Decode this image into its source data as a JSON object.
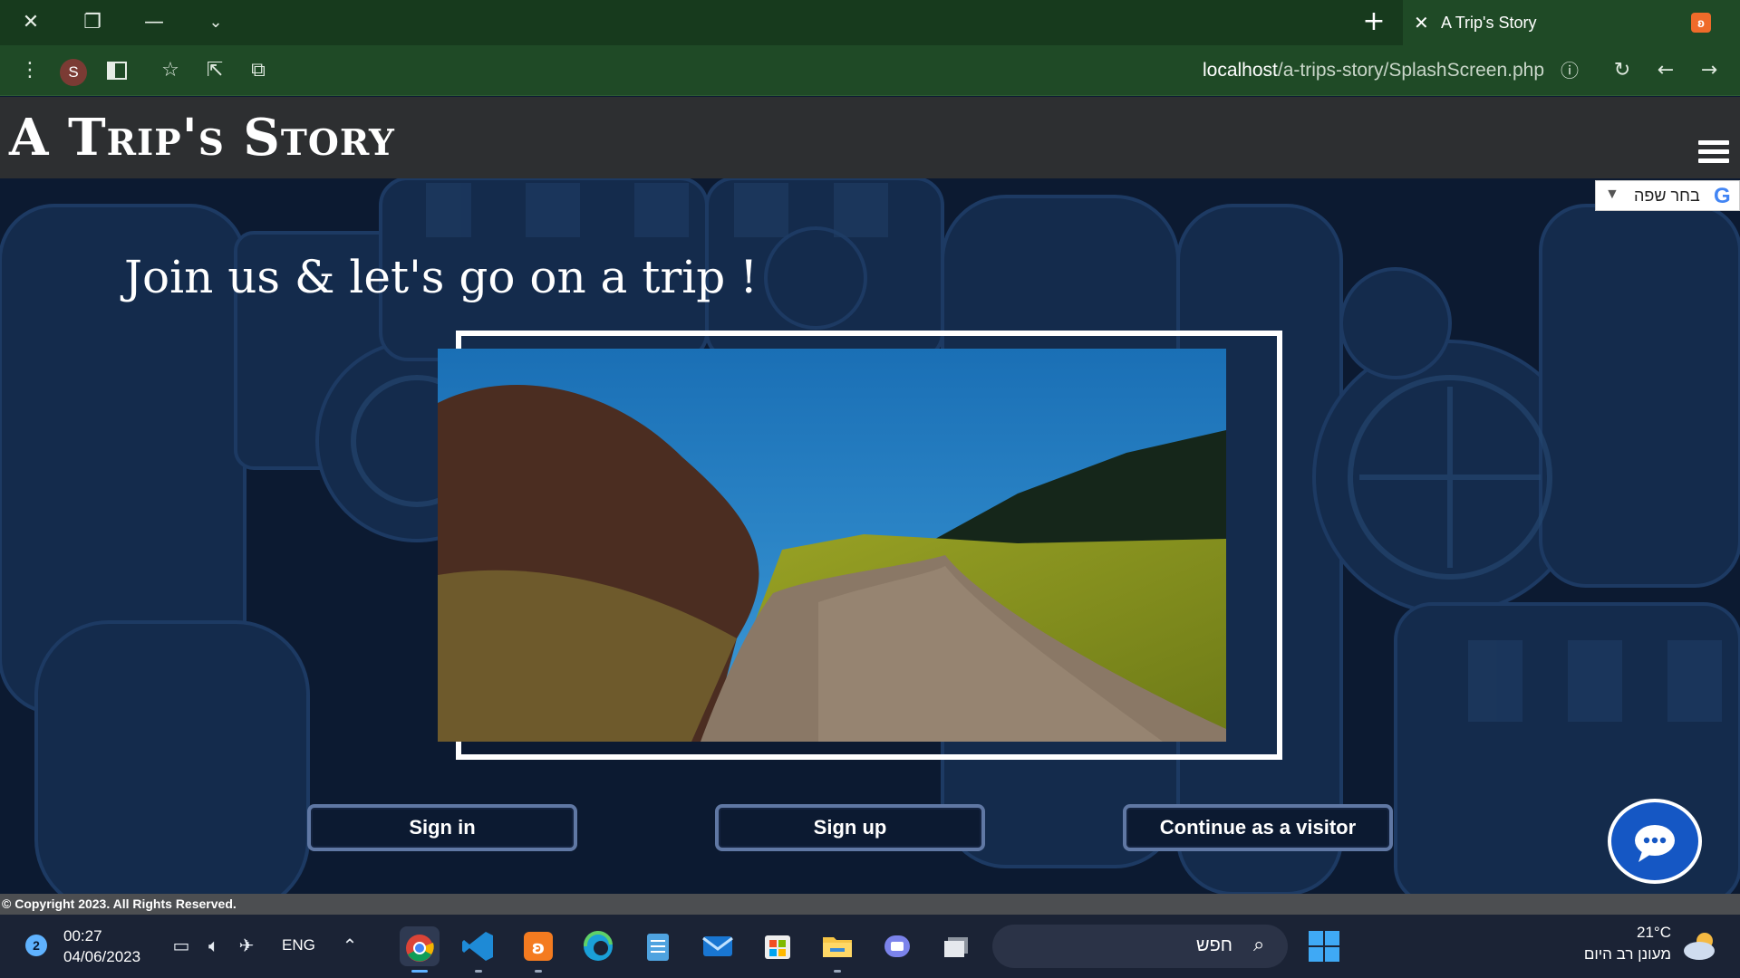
{
  "browser": {
    "tab_title": "A Trip's Story",
    "tab_favicon": "ʚ",
    "url_host": "localhost",
    "url_path": "/a-trips-story/SplashScreen.php",
    "profile_initial": "S"
  },
  "site": {
    "logo": "A Trip's Story",
    "language_widget": "בחר שפה",
    "language_widget_arrow": "▼",
    "language_widget_logo": "G",
    "headline": "Join us & let's go on a trip !",
    "buttons": {
      "sign_in": "Sign in",
      "sign_up": "Sign up",
      "visitor": "Continue as a visitor"
    },
    "footer": "© Copyright 2023. All Rights Reserved."
  },
  "taskbar": {
    "notification_count": "2",
    "time": "00:27",
    "date": "04/06/2023",
    "language": "ENG",
    "search_label": "חפש",
    "weather_temp": "21°C",
    "weather_desc": "מעונן רב היום"
  },
  "colors": {
    "titlebar": "#173a1d",
    "toolbar": "#1f4a26",
    "page_bg": "#0c1a31",
    "header": "#2d2f31",
    "button_border": "#6078a4",
    "chat_button": "#1557c4",
    "footer": "#4c4e51",
    "taskbar": "#1b2335"
  },
  "icons": [
    "close-icon",
    "restore-icon",
    "minimize-icon",
    "chevron-down-icon",
    "plus-icon",
    "menu-dots-icon",
    "sidebar-icon",
    "star-icon",
    "share-icon",
    "extension-icon",
    "info-icon",
    "reload-icon",
    "back-arrow-icon",
    "forward-arrow-icon",
    "hamburger-icon",
    "chat-icon",
    "battery-icon",
    "volume-icon",
    "airplane-icon",
    "chevron-up-icon",
    "search-icon",
    "windows-start-icon",
    "cloud-icon"
  ]
}
